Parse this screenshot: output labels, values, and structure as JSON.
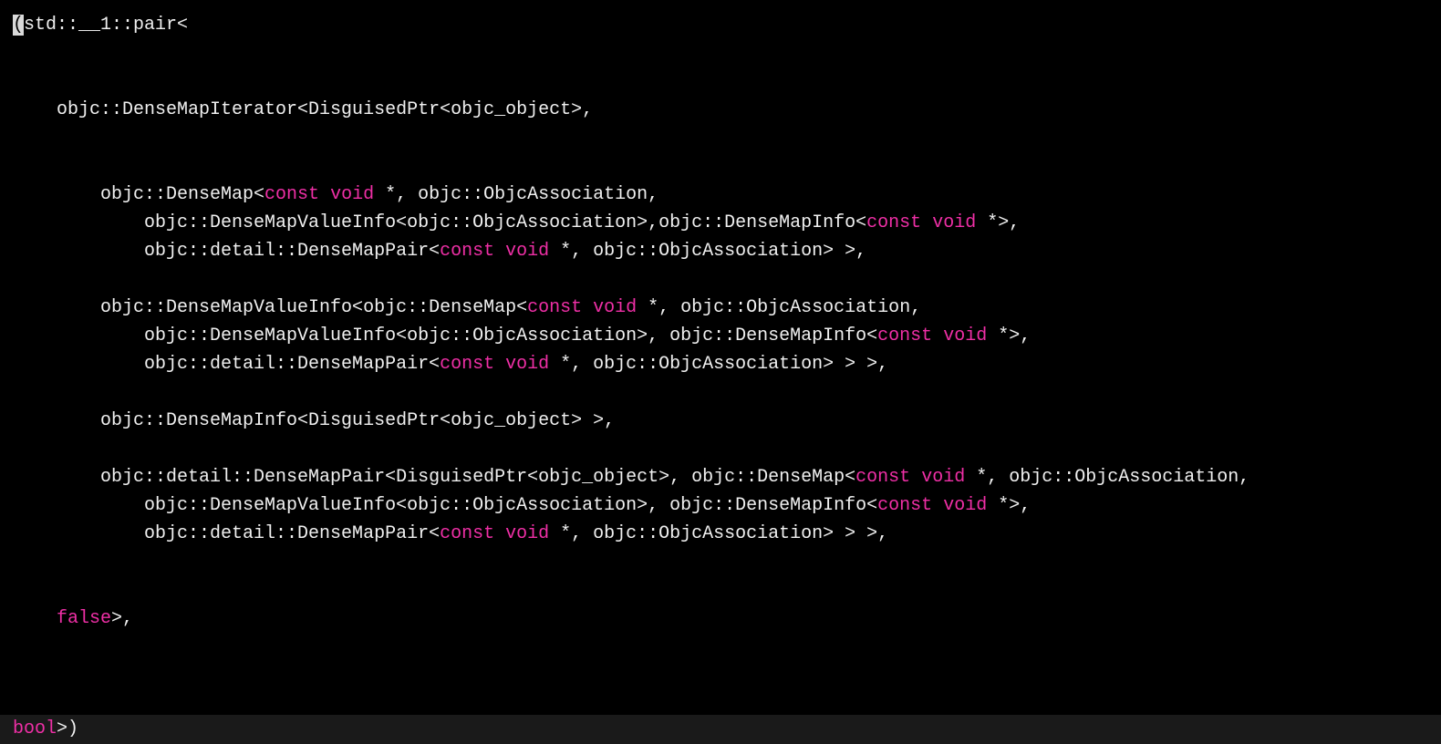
{
  "code": {
    "l1": {
      "a": "(",
      "b": "std::__1::pair<"
    },
    "l2": "",
    "l3": "",
    "l4": "    objc::DenseMapIterator<DisguisedPtr<objc_object>,",
    "l5": "",
    "l6": "",
    "l7": {
      "a": "        objc::DenseMap<",
      "kw1": "const",
      "sp1": " ",
      "kw2": "void",
      "b": " *, objc::ObjcAssociation,"
    },
    "l8": {
      "a": "            objc::DenseMapValueInfo<objc::ObjcAssociation>,objc::DenseMapInfo<",
      "kw1": "const",
      "sp1": " ",
      "kw2": "void",
      "b": " *>,"
    },
    "l9": {
      "a": "            objc::detail::DenseMapPair<",
      "kw1": "const",
      "sp1": " ",
      "kw2": "void",
      "b": " *, objc::ObjcAssociation> >,"
    },
    "l10": "",
    "l11": {
      "a": "        objc::DenseMapValueInfo<objc::DenseMap<",
      "kw1": "const",
      "sp1": " ",
      "kw2": "void",
      "b": " *, objc::ObjcAssociation,"
    },
    "l12": {
      "a": "            objc::DenseMapValueInfo<objc::ObjcAssociation>, objc::DenseMapInfo<",
      "kw1": "const",
      "sp1": " ",
      "kw2": "void",
      "b": " *>,"
    },
    "l13": {
      "a": "            objc::detail::DenseMapPair<",
      "kw1": "const",
      "sp1": " ",
      "kw2": "void",
      "b": " *, objc::ObjcAssociation> > >,"
    },
    "l14": "",
    "l15": "        objc::DenseMapInfo<DisguisedPtr<objc_object> >,",
    "l16": "",
    "l17": {
      "a": "        objc::detail::DenseMapPair<DisguisedPtr<objc_object>, objc::DenseMap<",
      "kw1": "const",
      "sp1": " ",
      "kw2": "void",
      "b": " *, objc::ObjcAssociation,"
    },
    "l18": {
      "a": "            objc::DenseMapValueInfo<objc::ObjcAssociation>, objc::DenseMapInfo<",
      "kw1": "const",
      "sp1": " ",
      "kw2": "void",
      "b": " *>,"
    },
    "l19": {
      "a": "            objc::detail::DenseMapPair<",
      "kw1": "const",
      "sp1": " ",
      "kw2": "void",
      "b": " *, objc::ObjcAssociation> > >,"
    },
    "l20": "",
    "l21": "",
    "l22": {
      "a": "    ",
      "kw1": "false",
      "b": ">,"
    },
    "l23": ""
  },
  "status": {
    "kw": "bool",
    "rest": ">)"
  }
}
